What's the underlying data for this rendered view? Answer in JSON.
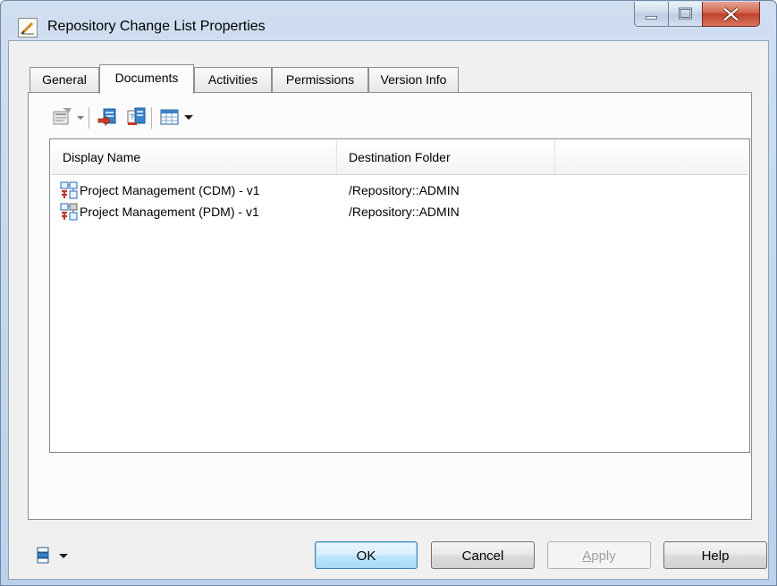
{
  "window": {
    "title": "Repository Change List Properties",
    "icon": "properties-edit-icon"
  },
  "tabs": [
    {
      "label": "General"
    },
    {
      "label": "Documents",
      "active": true
    },
    {
      "label": "Activities"
    },
    {
      "label": "Permissions"
    },
    {
      "label": "Version Info"
    }
  ],
  "toolbar": {
    "items": [
      "properties-icon",
      "dropdown-arrow-icon",
      "remove-icon",
      "open-icon",
      "customize-columns-icon",
      "dropdown-arrow-icon"
    ]
  },
  "list": {
    "columns": [
      "Display Name",
      "Destination Folder"
    ],
    "rows": [
      {
        "name": "Project Management (CDM) - v1",
        "folder": "/Repository::ADMIN",
        "icon": "cdm-model-icon"
      },
      {
        "name": "Project Management (PDM) - v1",
        "folder": "/Repository::ADMIN",
        "icon": "pdm-model-icon"
      }
    ]
  },
  "buttons": {
    "ok": "OK",
    "cancel": "Cancel",
    "apply_accel": "A",
    "apply_rest": "pply",
    "help": "Help"
  },
  "colors": {
    "accent": "#3c7fb1",
    "close_button": "#c0402a"
  }
}
